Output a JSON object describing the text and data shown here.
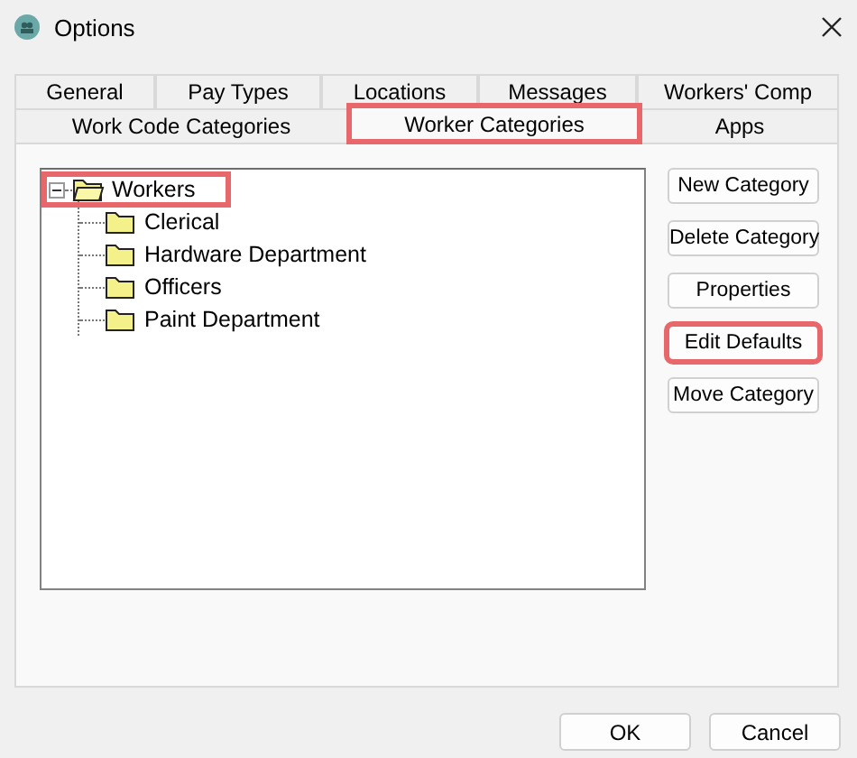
{
  "window": {
    "title": "Options"
  },
  "tab_rows": [
    [
      {
        "label": "General",
        "selected": false,
        "highlighted": false
      },
      {
        "label": "Pay Types",
        "selected": false,
        "highlighted": false
      },
      {
        "label": "Locations",
        "selected": false,
        "highlighted": false
      },
      {
        "label": "Messages",
        "selected": false,
        "highlighted": false
      },
      {
        "label": "Workers' Comp",
        "selected": false,
        "highlighted": false
      }
    ],
    [
      {
        "label": "Work Code Categories",
        "selected": false,
        "highlighted": false
      },
      {
        "label": "Worker Categories",
        "selected": true,
        "highlighted": true
      },
      {
        "label": "Apps",
        "selected": false,
        "highlighted": false
      }
    ]
  ],
  "tree": {
    "label": "Workers",
    "expanded": true,
    "highlighted": true,
    "children": [
      {
        "label": "Clerical"
      },
      {
        "label": "Hardware Department"
      },
      {
        "label": "Officers"
      },
      {
        "label": "Paint Department"
      }
    ]
  },
  "side_buttons": [
    {
      "label": "New Category",
      "highlighted": false
    },
    {
      "label": "Delete Category",
      "highlighted": false
    },
    {
      "label": "Properties",
      "highlighted": false
    },
    {
      "label": "Edit Defaults",
      "highlighted": true
    },
    {
      "label": "Move Category",
      "highlighted": false
    }
  ],
  "buttons": [
    "OK",
    "Cancel"
  ]
}
